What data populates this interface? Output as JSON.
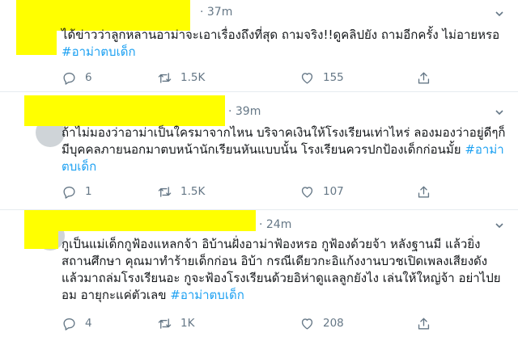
{
  "tweets": [
    {
      "time": "· 37m",
      "text": "ได้ข่าวว่าลูกหลานอาม่าจะเอาเรื่องถึงที่สุด ถามจริง!!ดูคลิปยัง ถามอีกครั้ง ไม่อายหรอ",
      "hashtag": "#อาม่าตบเด็ก",
      "replies": "6",
      "retweets": "1.5K",
      "likes": "155"
    },
    {
      "time": "· 39m",
      "text": "ถ้าไม่มองว่าอาม่าเป็นใครมาจากไหน บริจาคเงินให้โรงเรียนเท่าไหร่ ลองมองว่าอยู่ดีๆก็มีบุคคลภายนอกมาตบหน้านักเรียนหันแบบนั้น โรงเรียนควรปกป้องเด็กก่อนมั้ย",
      "hashtag": "#อาม่าตบเด็ก",
      "replies": "1",
      "retweets": "1.5K",
      "likes": "107"
    },
    {
      "time": "· 24m",
      "text": "กูเป็นแม่เด็กกูฟ้องแหลกจ้า อิบ้านฝั่งอาม่าฟ้องหรอ กูฟ้องด้วยจ้า หลังฐานมี แล้วยิ่งสถานศึกษา คุณมาทำร้ายเด็กก่อน อิบ้า กรณีเดียวกะอิแก้งงานบวชเปิดเพลงเสียงดังแล้วมาถล่มโรงเรียนอะ กูจะฟ้องโรงเรียนด้วยอิห่าดูแลลูกยังไง เล่นให้ใหญ่จ้า อย่าไปยอม อายุกะแค่ตัวเลข",
      "hashtag": "#อาม่าตบเด็ก",
      "replies": "4",
      "retweets": "1K",
      "likes": "208"
    }
  ],
  "colors": {
    "hashtag": "#1da1f2",
    "muted": "#657786",
    "redaction": "#ffff00"
  },
  "icons": [
    "reply-icon",
    "retweet-icon",
    "like-icon",
    "share-icon",
    "caret-down-icon"
  ]
}
